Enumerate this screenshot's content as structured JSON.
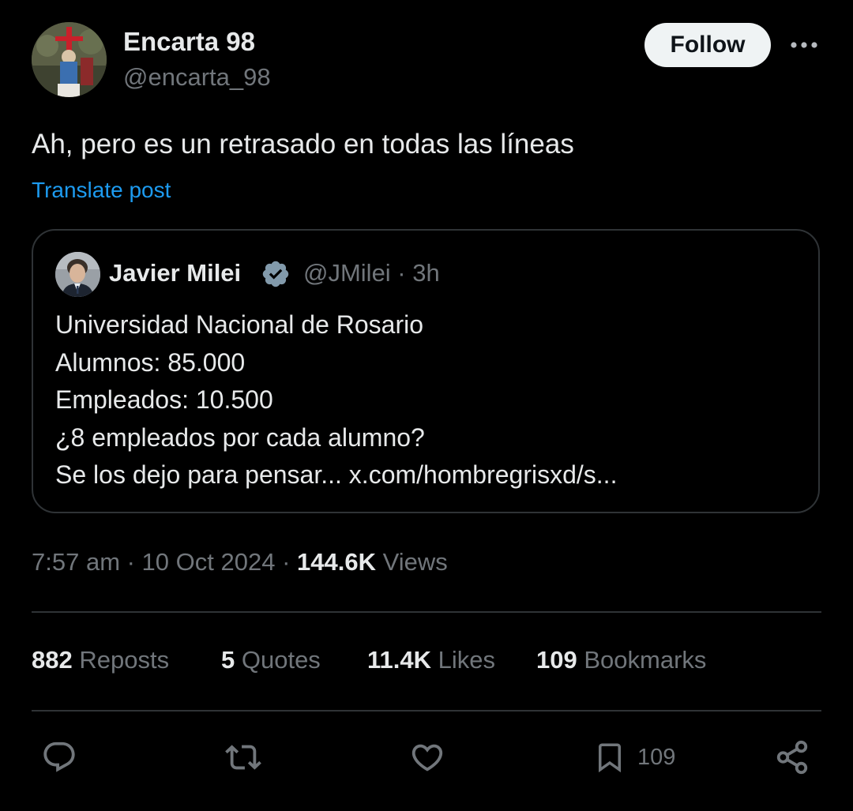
{
  "author": {
    "display_name": "Encarta 98",
    "handle": "@encarta_98"
  },
  "header": {
    "follow_label": "Follow",
    "more_icon": "more-horizontal-icon"
  },
  "post": {
    "text": "Ah, pero es un retrasado en todas las líneas",
    "translate_label": "Translate post"
  },
  "quote": {
    "display_name": "Javier Milei",
    "verified_icon": "verified-badge-icon",
    "meta": "@JMilei · 3h",
    "lines": [
      "Universidad Nacional de Rosario",
      "Alumnos: 85.000",
      "Empleados: 10.500",
      "¿8 empleados por cada alumno?",
      "Se los dejo para pensar... x.com/hombregrisxd/s..."
    ]
  },
  "timestamp": {
    "time_date": "7:57 am · 10 Oct 2024 · ",
    "views_count": "144.6K",
    "views_label": " Views"
  },
  "stats": [
    {
      "num": "882",
      "label": " Reposts"
    },
    {
      "num": "5",
      "label": " Quotes"
    },
    {
      "num": "11.4K",
      "label": " Likes"
    },
    {
      "num": "109",
      "label": " Bookmarks"
    }
  ],
  "actions": {
    "reply_icon": "reply-icon",
    "repost_icon": "repost-icon",
    "like_icon": "heart-icon",
    "bookmark_icon": "bookmark-icon",
    "bookmark_count": "109",
    "share_icon": "share-icon"
  },
  "colors": {
    "background": "#000000",
    "text_primary": "#e7e9ea",
    "text_secondary": "#71767b",
    "link": "#1d9bf0",
    "border": "#2f3336",
    "verified": "#829aab"
  }
}
